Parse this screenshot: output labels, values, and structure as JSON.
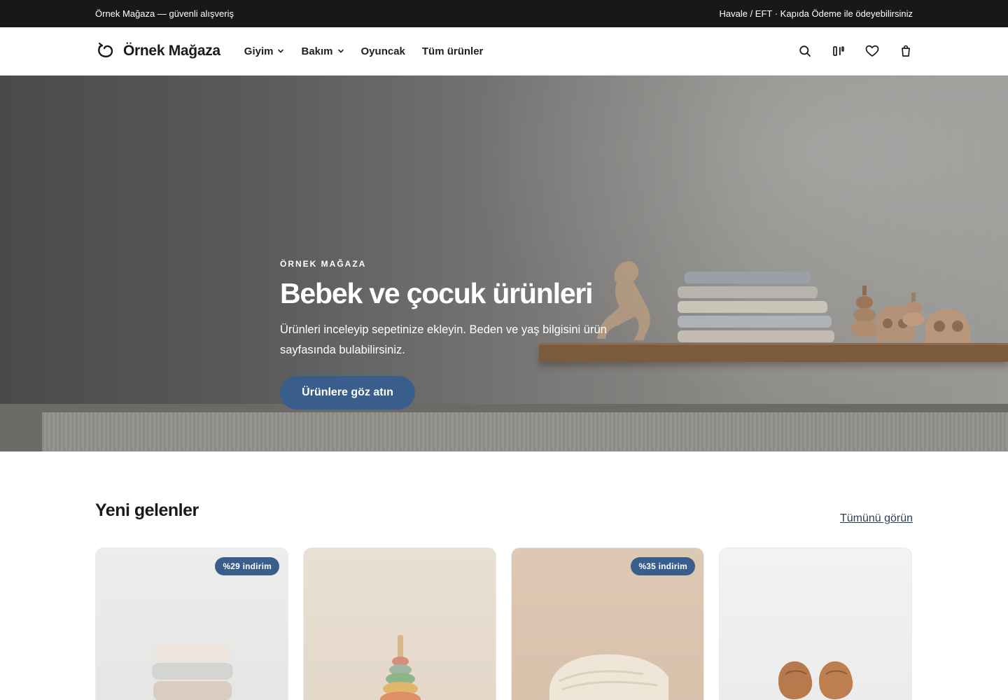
{
  "topbar": {
    "left_text": "Örnek Mağaza — güvenli alışveriş",
    "right_text": "Havale / EFT · Kapıda Ödeme ile ödeyebilirsiniz"
  },
  "header": {
    "logo_text": "Örnek Mağaza",
    "nav": [
      {
        "label": "Giyim",
        "has_dropdown": true
      },
      {
        "label": "Bakım",
        "has_dropdown": true
      },
      {
        "label": "Oyuncak",
        "has_dropdown": false
      },
      {
        "label": "Tüm ürünler",
        "has_dropdown": false
      }
    ],
    "icons": [
      "search-icon",
      "compare-icon",
      "heart-icon",
      "bag-icon"
    ]
  },
  "hero": {
    "eyebrow": "ÖRNEK MAĞAZA",
    "title": "Bebek ve çocuk ürünleri",
    "text": "Ürünleri inceleyip sepetinize ekleyin. Beden ve yaş bilgisini ürün sayfasında bulabilirsiniz.",
    "button_label": "Ürünlere göz atın"
  },
  "new_arrivals": {
    "title": "Yeni gelenler",
    "view_all_label": "Tümünü görün",
    "products": [
      {
        "badge": "%29 indirim"
      },
      {
        "badge": ""
      },
      {
        "badge": "%35 indirim"
      },
      {
        "badge": ""
      }
    ]
  },
  "colors": {
    "accent": "#3a5e8c",
    "topbar_bg": "#17181a"
  }
}
